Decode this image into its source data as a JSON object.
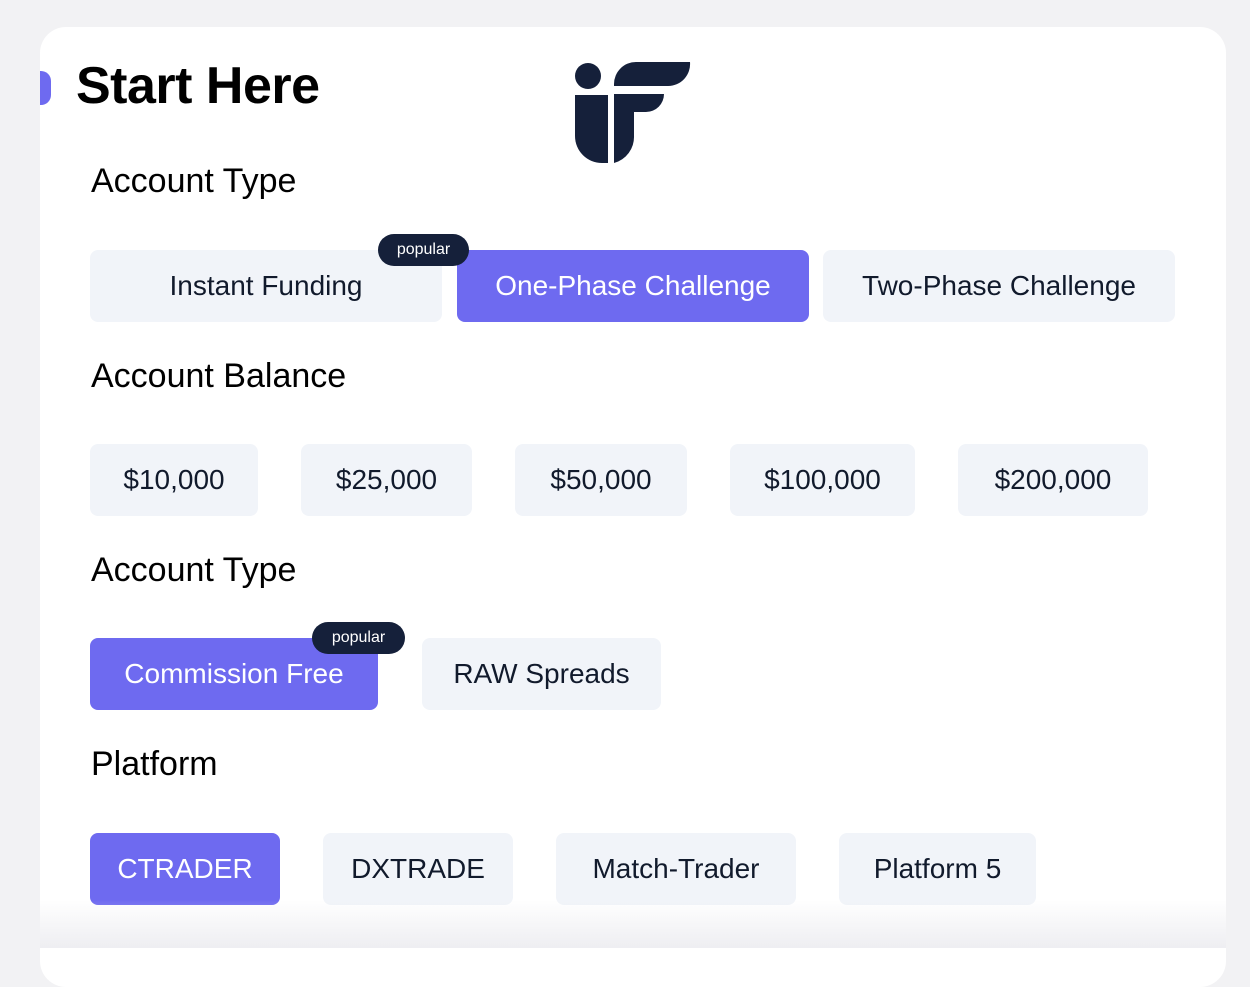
{
  "header": {
    "title": "Start Here",
    "logo_icon": "if-brand-logo-icon"
  },
  "sections": {
    "account_type": {
      "heading": "Account Type",
      "options": [
        "Instant Funding",
        "One-Phase Challenge",
        "Two-Phase Challenge"
      ],
      "selected": "One-Phase Challenge",
      "badge": "popular"
    },
    "account_balance": {
      "heading": "Account Balance",
      "options": [
        "$10,000",
        "$25,000",
        "$50,000",
        "$100,000",
        "$200,000"
      ]
    },
    "account_type_2": {
      "heading": "Account Type",
      "options": [
        "Commission Free",
        "RAW Spreads"
      ],
      "selected": "Commission Free",
      "badge": "popular"
    },
    "platform": {
      "heading": "Platform",
      "options": [
        "CTRADER",
        "DXTRADE",
        "Match-Trader",
        "Platform 5"
      ],
      "selected": "CTRADER"
    }
  },
  "colors": {
    "accent": "#6e6af0",
    "option_bg": "#f1f4f9",
    "option_text": "#111a2c",
    "badge_bg": "#15203a"
  }
}
